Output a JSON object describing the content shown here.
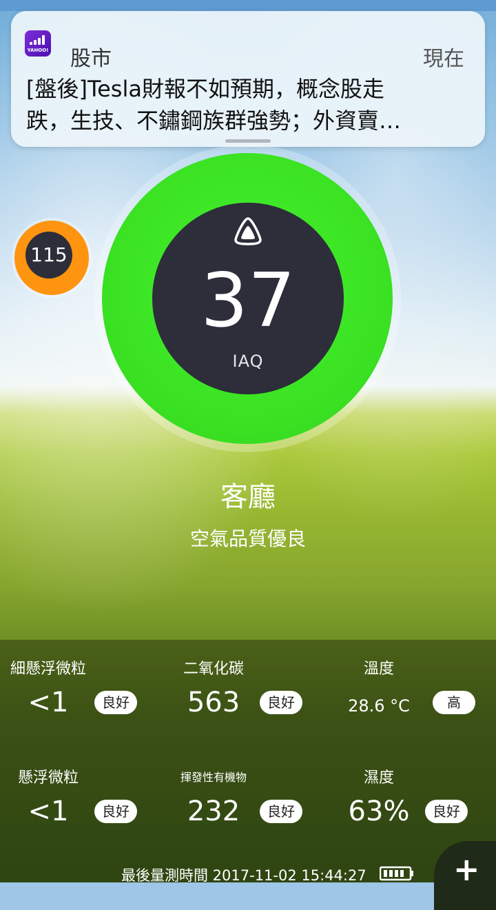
{
  "notification": {
    "app_name": "股市",
    "app_icon": "yahoo-finance-icon",
    "app_icon_text": "YAHOO!",
    "time": "現在",
    "message": "[盤後]Tesla財報不如預期，概念股走\n跌，生技、不鏽鋼族群強勢；外資賣…"
  },
  "iaq": {
    "value": "37",
    "label": "IAQ",
    "icon": "alert-bell-icon",
    "ring_color": "#3de324",
    "level": 0.37
  },
  "side_sensor": {
    "value": "115",
    "ring_color": "#ff9410"
  },
  "room": {
    "name": "客廳",
    "status": "空氣品質優良"
  },
  "metrics": [
    {
      "title": "細懸浮微粒",
      "value": "<1",
      "badge": "良好"
    },
    {
      "title": "二氧化碳",
      "value": "563",
      "badge": "良好"
    },
    {
      "title": "溫度",
      "value": "28.6 °C",
      "badge": "高"
    },
    {
      "title": "懸浮微粒",
      "value": "<1",
      "badge": "良好"
    },
    {
      "title": "揮發性有機物",
      "value": "232",
      "badge": "良好"
    },
    {
      "title": "濕度",
      "value": "63%",
      "badge": "良好"
    }
  ],
  "footer": {
    "text": "最後量測時間 2017-11-02 15:44:27",
    "battery_icon": "battery-icon"
  },
  "fab": {
    "label": "+",
    "icon": "plus-icon"
  }
}
